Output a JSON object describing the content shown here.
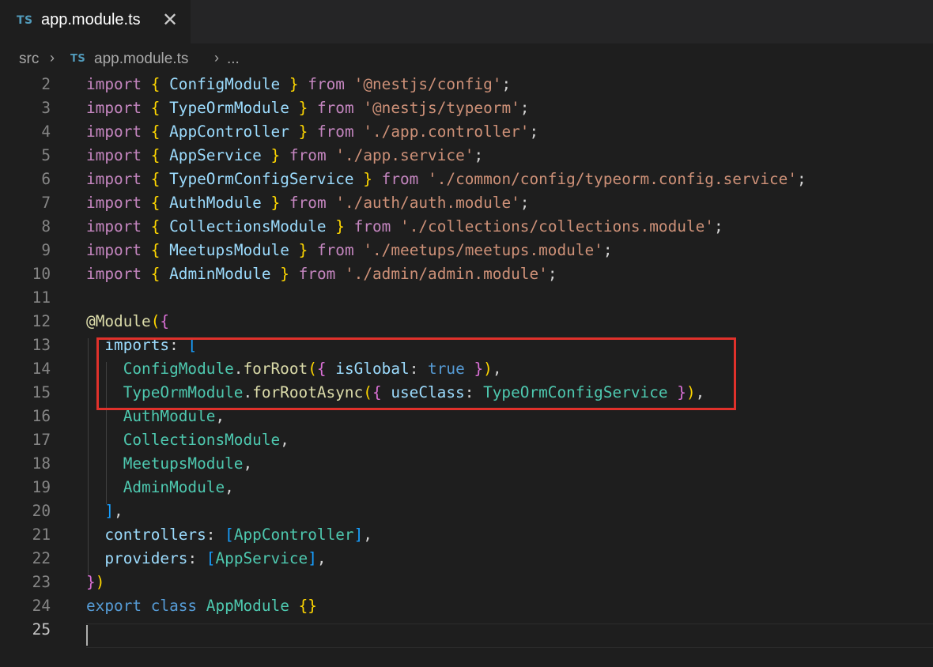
{
  "tab": {
    "icon": "TS",
    "title": "app.module.ts",
    "close_icon": "✕"
  },
  "breadcrumb": {
    "folder": "src",
    "icon": "TS",
    "file": "app.module.ts",
    "more": "...",
    "sep": "›"
  },
  "editor": {
    "lines": [
      {
        "n": "2",
        "tokens": [
          [
            "import",
            "kw"
          ],
          [
            " ",
            ""
          ],
          [
            "{",
            "b1"
          ],
          [
            " ",
            ""
          ],
          [
            "ConfigModule",
            "vr"
          ],
          [
            " ",
            ""
          ],
          [
            "}",
            "b1"
          ],
          [
            " ",
            ""
          ],
          [
            "from",
            "kw"
          ],
          [
            " ",
            ""
          ],
          [
            "'@nestjs/config'",
            "st"
          ],
          [
            ";",
            "pun"
          ]
        ]
      },
      {
        "n": "3",
        "tokens": [
          [
            "import",
            "kw"
          ],
          [
            " ",
            ""
          ],
          [
            "{",
            "b1"
          ],
          [
            " ",
            ""
          ],
          [
            "TypeOrmModule",
            "vr"
          ],
          [
            " ",
            ""
          ],
          [
            "}",
            "b1"
          ],
          [
            " ",
            ""
          ],
          [
            "from",
            "kw"
          ],
          [
            " ",
            ""
          ],
          [
            "'@nestjs/typeorm'",
            "st"
          ],
          [
            ";",
            "pun"
          ]
        ]
      },
      {
        "n": "4",
        "tokens": [
          [
            "import",
            "kw"
          ],
          [
            " ",
            ""
          ],
          [
            "{",
            "b1"
          ],
          [
            " ",
            ""
          ],
          [
            "AppController",
            "vr"
          ],
          [
            " ",
            ""
          ],
          [
            "}",
            "b1"
          ],
          [
            " ",
            ""
          ],
          [
            "from",
            "kw"
          ],
          [
            " ",
            ""
          ],
          [
            "'./app.controller'",
            "st"
          ],
          [
            ";",
            "pun"
          ]
        ]
      },
      {
        "n": "5",
        "tokens": [
          [
            "import",
            "kw"
          ],
          [
            " ",
            ""
          ],
          [
            "{",
            "b1"
          ],
          [
            " ",
            ""
          ],
          [
            "AppService",
            "vr"
          ],
          [
            " ",
            ""
          ],
          [
            "}",
            "b1"
          ],
          [
            " ",
            ""
          ],
          [
            "from",
            "kw"
          ],
          [
            " ",
            ""
          ],
          [
            "'./app.service'",
            "st"
          ],
          [
            ";",
            "pun"
          ]
        ]
      },
      {
        "n": "6",
        "tokens": [
          [
            "import",
            "kw"
          ],
          [
            " ",
            ""
          ],
          [
            "{",
            "b1"
          ],
          [
            " ",
            ""
          ],
          [
            "TypeOrmConfigService",
            "vr"
          ],
          [
            " ",
            ""
          ],
          [
            "}",
            "b1"
          ],
          [
            " ",
            ""
          ],
          [
            "from",
            "kw"
          ],
          [
            " ",
            ""
          ],
          [
            "'./common/config/typeorm.config.service'",
            "st"
          ],
          [
            ";",
            "pun"
          ]
        ]
      },
      {
        "n": "7",
        "tokens": [
          [
            "import",
            "kw"
          ],
          [
            " ",
            ""
          ],
          [
            "{",
            "b1"
          ],
          [
            " ",
            ""
          ],
          [
            "AuthModule",
            "vr"
          ],
          [
            " ",
            ""
          ],
          [
            "}",
            "b1"
          ],
          [
            " ",
            ""
          ],
          [
            "from",
            "kw"
          ],
          [
            " ",
            ""
          ],
          [
            "'./auth/auth.module'",
            "st"
          ],
          [
            ";",
            "pun"
          ]
        ]
      },
      {
        "n": "8",
        "tokens": [
          [
            "import",
            "kw"
          ],
          [
            " ",
            ""
          ],
          [
            "{",
            "b1"
          ],
          [
            " ",
            ""
          ],
          [
            "CollectionsModule",
            "vr"
          ],
          [
            " ",
            ""
          ],
          [
            "}",
            "b1"
          ],
          [
            " ",
            ""
          ],
          [
            "from",
            "kw"
          ],
          [
            " ",
            ""
          ],
          [
            "'./collections/collections.module'",
            "st"
          ],
          [
            ";",
            "pun"
          ]
        ]
      },
      {
        "n": "9",
        "tokens": [
          [
            "import",
            "kw"
          ],
          [
            " ",
            ""
          ],
          [
            "{",
            "b1"
          ],
          [
            " ",
            ""
          ],
          [
            "MeetupsModule",
            "vr"
          ],
          [
            " ",
            ""
          ],
          [
            "}",
            "b1"
          ],
          [
            " ",
            ""
          ],
          [
            "from",
            "kw"
          ],
          [
            " ",
            ""
          ],
          [
            "'./meetups/meetups.module'",
            "st"
          ],
          [
            ";",
            "pun"
          ]
        ]
      },
      {
        "n": "10",
        "tokens": [
          [
            "import",
            "kw"
          ],
          [
            " ",
            ""
          ],
          [
            "{",
            "b1"
          ],
          [
            " ",
            ""
          ],
          [
            "AdminModule",
            "vr"
          ],
          [
            " ",
            ""
          ],
          [
            "}",
            "b1"
          ],
          [
            " ",
            ""
          ],
          [
            "from",
            "kw"
          ],
          [
            " ",
            ""
          ],
          [
            "'./admin/admin.module'",
            "st"
          ],
          [
            ";",
            "pun"
          ]
        ]
      },
      {
        "n": "11",
        "tokens": []
      },
      {
        "n": "12",
        "tokens": [
          [
            "@",
            "fn"
          ],
          [
            "Module",
            "fn"
          ],
          [
            "(",
            "b1"
          ],
          [
            "{",
            "b2"
          ]
        ]
      },
      {
        "n": "13",
        "tokens": [
          [
            "  ",
            ""
          ],
          [
            "imports",
            "vr"
          ],
          [
            ": ",
            "pun"
          ],
          [
            "[",
            "b3"
          ]
        ]
      },
      {
        "n": "14",
        "tokens": [
          [
            "    ",
            ""
          ],
          [
            "ConfigModule",
            "cls"
          ],
          [
            ".",
            "pun"
          ],
          [
            "forRoot",
            "fn"
          ],
          [
            "(",
            "b1"
          ],
          [
            "{",
            "b2"
          ],
          [
            " ",
            ""
          ],
          [
            "isGlobal",
            "vr"
          ],
          [
            ": ",
            "pun"
          ],
          [
            "true",
            "bl"
          ],
          [
            " ",
            ""
          ],
          [
            "}",
            "b2"
          ],
          [
            ")",
            "b1"
          ],
          [
            ",",
            "pun"
          ]
        ]
      },
      {
        "n": "15",
        "tokens": [
          [
            "    ",
            ""
          ],
          [
            "TypeOrmModule",
            "cls"
          ],
          [
            ".",
            "pun"
          ],
          [
            "forRootAsync",
            "fn"
          ],
          [
            "(",
            "b1"
          ],
          [
            "{",
            "b2"
          ],
          [
            " ",
            ""
          ],
          [
            "useClass",
            "vr"
          ],
          [
            ": ",
            "pun"
          ],
          [
            "TypeOrmConfigService",
            "cls"
          ],
          [
            " ",
            ""
          ],
          [
            "}",
            "b2"
          ],
          [
            ")",
            "b1"
          ],
          [
            ",",
            "pun"
          ]
        ]
      },
      {
        "n": "16",
        "tokens": [
          [
            "    ",
            ""
          ],
          [
            "AuthModule",
            "cls"
          ],
          [
            ",",
            "pun"
          ]
        ]
      },
      {
        "n": "17",
        "tokens": [
          [
            "    ",
            ""
          ],
          [
            "CollectionsModule",
            "cls"
          ],
          [
            ",",
            "pun"
          ]
        ]
      },
      {
        "n": "18",
        "tokens": [
          [
            "    ",
            ""
          ],
          [
            "MeetupsModule",
            "cls"
          ],
          [
            ",",
            "pun"
          ]
        ]
      },
      {
        "n": "19",
        "tokens": [
          [
            "    ",
            ""
          ],
          [
            "AdminModule",
            "cls"
          ],
          [
            ",",
            "pun"
          ]
        ]
      },
      {
        "n": "20",
        "tokens": [
          [
            "  ",
            ""
          ],
          [
            "]",
            "b3"
          ],
          [
            ",",
            "pun"
          ]
        ]
      },
      {
        "n": "21",
        "tokens": [
          [
            "  ",
            ""
          ],
          [
            "controllers",
            "vr"
          ],
          [
            ": ",
            "pun"
          ],
          [
            "[",
            "b3"
          ],
          [
            "AppController",
            "cls"
          ],
          [
            "]",
            "b3"
          ],
          [
            ",",
            "pun"
          ]
        ]
      },
      {
        "n": "22",
        "tokens": [
          [
            "  ",
            ""
          ],
          [
            "providers",
            "vr"
          ],
          [
            ": ",
            "pun"
          ],
          [
            "[",
            "b3"
          ],
          [
            "AppService",
            "cls"
          ],
          [
            "]",
            "b3"
          ],
          [
            ",",
            "pun"
          ]
        ]
      },
      {
        "n": "23",
        "tokens": [
          [
            "}",
            "b2"
          ],
          [
            ")",
            "b1"
          ]
        ]
      },
      {
        "n": "24",
        "tokens": [
          [
            "export",
            "bl"
          ],
          [
            " ",
            ""
          ],
          [
            "class",
            "bl"
          ],
          [
            " ",
            ""
          ],
          [
            "AppModule",
            "cls"
          ],
          [
            " ",
            ""
          ],
          [
            "{}",
            "b1"
          ]
        ]
      },
      {
        "n": "25",
        "tokens": [],
        "active": true
      }
    ]
  },
  "annotation": {
    "color": "#e0312b"
  }
}
